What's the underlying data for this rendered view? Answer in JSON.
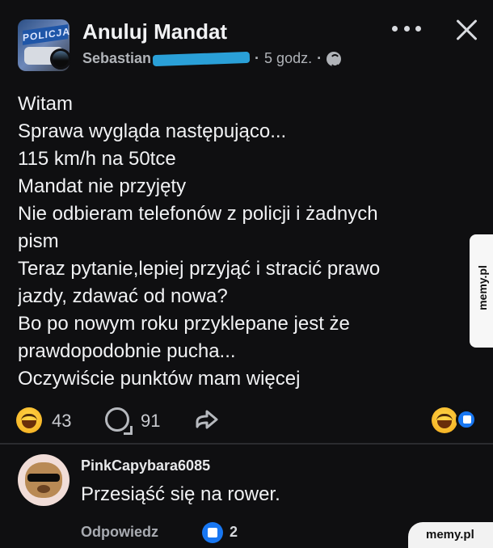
{
  "post": {
    "group_name": "Anuluj Mandat",
    "group_logo_text": "POLICJA",
    "author": "Sebastian",
    "time": "5 godz.",
    "separator": "·",
    "body_lines": [
      "Witam",
      "Sprawa wygląda następująco...",
      "115 km/h na 50tce",
      "Mandat nie przyjęty",
      "Nie odbieram telefonów z policji i żadnych",
      "pism",
      "Teraz pytanie,lepiej przyjąć i stracić prawo",
      "jazdy, zdawać od nowa?",
      "Bo po nowym roku przyklepane jest że",
      "prawdopodobnie pucha...",
      "Oczywiście punktów mam więcej"
    ],
    "reaction_count": "43",
    "comment_count": "91"
  },
  "comment": {
    "author": "PinkCapybara6085",
    "text": "Przesiąść się na rower.",
    "reply_label": "Odpowiedz",
    "like_count": "2"
  },
  "watermarks": {
    "side": "memy.pl",
    "corner": "memy.pl"
  },
  "icons": {
    "more": "more-horizontal-icon",
    "close": "close-icon",
    "globe": "globe-icon",
    "comment": "comment-bubble-icon",
    "share": "share-icon",
    "like": "thumbs-up-icon",
    "haha": "laughing-emoji-icon"
  }
}
